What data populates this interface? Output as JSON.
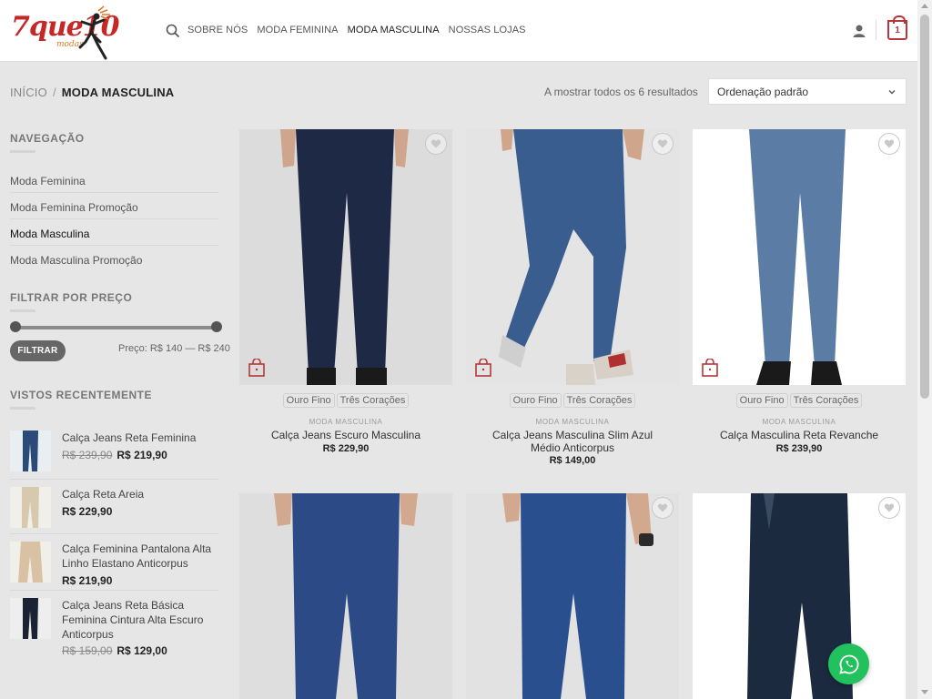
{
  "header": {
    "logo_text": "7que10",
    "logo_sub": "modas",
    "nav": [
      "SOBRE NÓS",
      "MODA FEMININA",
      "MODA MASCULINA",
      "NOSSAS LOJAS"
    ],
    "cart_count": "1"
  },
  "breadcrumb": {
    "home": "INÍCIO",
    "separator": "/",
    "current": "MODA MASCULINA"
  },
  "results": "A mostrar todos os 6 resultados",
  "sort": {
    "selected": "Ordenação padrão"
  },
  "sidebar": {
    "nav_title": "NAVEGAÇÃO",
    "nav_items": [
      "Moda Feminina",
      "Moda Feminina Promoção",
      "Moda Masculina",
      "Moda Masculina Promoção"
    ],
    "filter_title": "FILTRAR POR PREÇO",
    "filter_button": "FILTRAR",
    "price_range": "Preço: R$ 140 — R$ 240",
    "recent_title": "VISTOS RECENTEMENTE",
    "recent": [
      {
        "name": "Calça Jeans Reta Feminina",
        "old_price": "R$ 239,90",
        "price": "R$ 219,90"
      },
      {
        "name": "Calça Reta Areia",
        "old_price": "",
        "price": "R$ 229,90"
      },
      {
        "name": "Calça Feminina Pantalona Alta Linho Elastano Anticorpus",
        "old_price": "",
        "price": "R$ 219,90"
      },
      {
        "name": "Calça Jeans Reta Básica Feminina Cintura Alta Escuro Anticorpus",
        "old_price": "R$ 159,00",
        "price": "R$ 129,00"
      }
    ]
  },
  "products": [
    {
      "brands": [
        "Ouro Fino",
        "Três Corações"
      ],
      "category": "MODA MASCULINA",
      "name": "Calça Jeans Escuro Masculina",
      "price": "R$ 229,90"
    },
    {
      "brands": [
        "Ouro Fino",
        "Três Corações"
      ],
      "category": "MODA MASCULINA",
      "name": "Calça Jeans Masculina Slim Azul Médio Anticorpus",
      "price": "R$ 149,00"
    },
    {
      "brands": [
        "Ouro Fino",
        "Três Corações"
      ],
      "category": "MODA MASCULINA",
      "name": "Calça Masculina Reta Revanche",
      "price": "R$ 239,90"
    },
    {
      "brands": [],
      "category": "",
      "name": "",
      "price": ""
    },
    {
      "brands": [],
      "category": "",
      "name": "",
      "price": ""
    },
    {
      "brands": [],
      "category": "",
      "name": "",
      "price": ""
    }
  ],
  "colors": {
    "accent": "#b63737",
    "whatsapp": "#23c15e",
    "bg": "#e6e6e6"
  }
}
